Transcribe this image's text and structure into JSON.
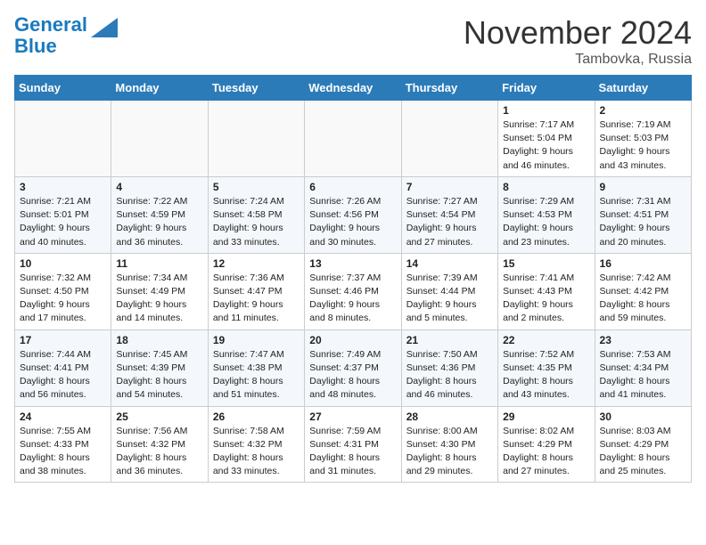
{
  "logo": {
    "line1": "General",
    "line2": "Blue"
  },
  "title": "November 2024",
  "location": "Tambovka, Russia",
  "days_header": [
    "Sunday",
    "Monday",
    "Tuesday",
    "Wednesday",
    "Thursday",
    "Friday",
    "Saturday"
  ],
  "weeks": [
    [
      {
        "day": "",
        "info": ""
      },
      {
        "day": "",
        "info": ""
      },
      {
        "day": "",
        "info": ""
      },
      {
        "day": "",
        "info": ""
      },
      {
        "day": "",
        "info": ""
      },
      {
        "day": "1",
        "info": "Sunrise: 7:17 AM\nSunset: 5:04 PM\nDaylight: 9 hours and 46 minutes."
      },
      {
        "day": "2",
        "info": "Sunrise: 7:19 AM\nSunset: 5:03 PM\nDaylight: 9 hours and 43 minutes."
      }
    ],
    [
      {
        "day": "3",
        "info": "Sunrise: 7:21 AM\nSunset: 5:01 PM\nDaylight: 9 hours and 40 minutes."
      },
      {
        "day": "4",
        "info": "Sunrise: 7:22 AM\nSunset: 4:59 PM\nDaylight: 9 hours and 36 minutes."
      },
      {
        "day": "5",
        "info": "Sunrise: 7:24 AM\nSunset: 4:58 PM\nDaylight: 9 hours and 33 minutes."
      },
      {
        "day": "6",
        "info": "Sunrise: 7:26 AM\nSunset: 4:56 PM\nDaylight: 9 hours and 30 minutes."
      },
      {
        "day": "7",
        "info": "Sunrise: 7:27 AM\nSunset: 4:54 PM\nDaylight: 9 hours and 27 minutes."
      },
      {
        "day": "8",
        "info": "Sunrise: 7:29 AM\nSunset: 4:53 PM\nDaylight: 9 hours and 23 minutes."
      },
      {
        "day": "9",
        "info": "Sunrise: 7:31 AM\nSunset: 4:51 PM\nDaylight: 9 hours and 20 minutes."
      }
    ],
    [
      {
        "day": "10",
        "info": "Sunrise: 7:32 AM\nSunset: 4:50 PM\nDaylight: 9 hours and 17 minutes."
      },
      {
        "day": "11",
        "info": "Sunrise: 7:34 AM\nSunset: 4:49 PM\nDaylight: 9 hours and 14 minutes."
      },
      {
        "day": "12",
        "info": "Sunrise: 7:36 AM\nSunset: 4:47 PM\nDaylight: 9 hours and 11 minutes."
      },
      {
        "day": "13",
        "info": "Sunrise: 7:37 AM\nSunset: 4:46 PM\nDaylight: 9 hours and 8 minutes."
      },
      {
        "day": "14",
        "info": "Sunrise: 7:39 AM\nSunset: 4:44 PM\nDaylight: 9 hours and 5 minutes."
      },
      {
        "day": "15",
        "info": "Sunrise: 7:41 AM\nSunset: 4:43 PM\nDaylight: 9 hours and 2 minutes."
      },
      {
        "day": "16",
        "info": "Sunrise: 7:42 AM\nSunset: 4:42 PM\nDaylight: 8 hours and 59 minutes."
      }
    ],
    [
      {
        "day": "17",
        "info": "Sunrise: 7:44 AM\nSunset: 4:41 PM\nDaylight: 8 hours and 56 minutes."
      },
      {
        "day": "18",
        "info": "Sunrise: 7:45 AM\nSunset: 4:39 PM\nDaylight: 8 hours and 54 minutes."
      },
      {
        "day": "19",
        "info": "Sunrise: 7:47 AM\nSunset: 4:38 PM\nDaylight: 8 hours and 51 minutes."
      },
      {
        "day": "20",
        "info": "Sunrise: 7:49 AM\nSunset: 4:37 PM\nDaylight: 8 hours and 48 minutes."
      },
      {
        "day": "21",
        "info": "Sunrise: 7:50 AM\nSunset: 4:36 PM\nDaylight: 8 hours and 46 minutes."
      },
      {
        "day": "22",
        "info": "Sunrise: 7:52 AM\nSunset: 4:35 PM\nDaylight: 8 hours and 43 minutes."
      },
      {
        "day": "23",
        "info": "Sunrise: 7:53 AM\nSunset: 4:34 PM\nDaylight: 8 hours and 41 minutes."
      }
    ],
    [
      {
        "day": "24",
        "info": "Sunrise: 7:55 AM\nSunset: 4:33 PM\nDaylight: 8 hours and 38 minutes."
      },
      {
        "day": "25",
        "info": "Sunrise: 7:56 AM\nSunset: 4:32 PM\nDaylight: 8 hours and 36 minutes."
      },
      {
        "day": "26",
        "info": "Sunrise: 7:58 AM\nSunset: 4:32 PM\nDaylight: 8 hours and 33 minutes."
      },
      {
        "day": "27",
        "info": "Sunrise: 7:59 AM\nSunset: 4:31 PM\nDaylight: 8 hours and 31 minutes."
      },
      {
        "day": "28",
        "info": "Sunrise: 8:00 AM\nSunset: 4:30 PM\nDaylight: 8 hours and 29 minutes."
      },
      {
        "day": "29",
        "info": "Sunrise: 8:02 AM\nSunset: 4:29 PM\nDaylight: 8 hours and 27 minutes."
      },
      {
        "day": "30",
        "info": "Sunrise: 8:03 AM\nSunset: 4:29 PM\nDaylight: 8 hours and 25 minutes."
      }
    ]
  ]
}
